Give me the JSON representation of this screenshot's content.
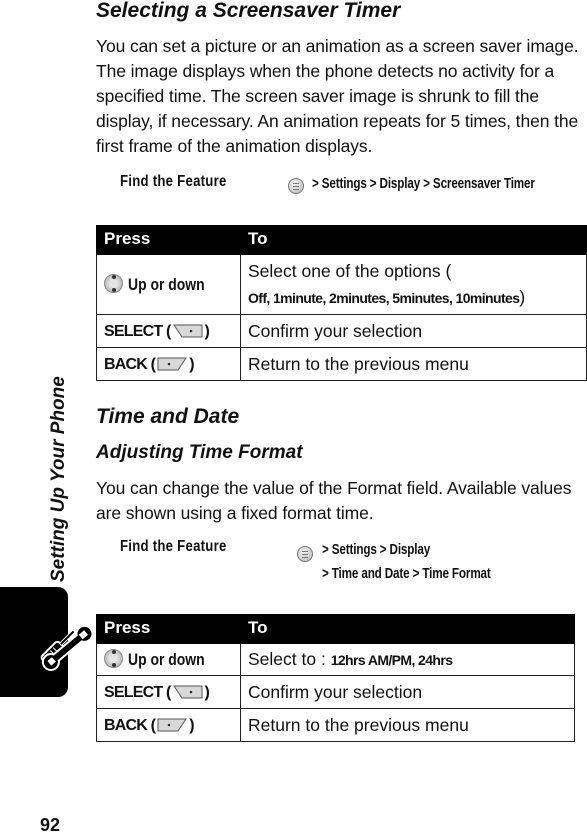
{
  "side_tab": {
    "label": "Setting Up Your Phone",
    "icon": "tools-icon"
  },
  "page_number": "92",
  "sections": [
    {
      "title": "Selecting a Screensaver Timer",
      "body": "You can set a picture or an animation as a screen saver image. The image displays when the phone detects no activity for a specified time. The screen saver image is shrunk to fill the display, if necessary. An animation repeats for 5 times, then the first frame of the animation displays.",
      "find_feature": {
        "label": "Find the Feature",
        "icon": "menu-key-icon",
        "path_lines": [
          "> Settings > Display > Screensaver Timer"
        ]
      },
      "table": {
        "headers": [
          "Press",
          "To"
        ],
        "rows": [
          {
            "press_icon": "nav-key-icon",
            "press": "Up or down",
            "to_prefix": "Select one of the options (",
            "to_options": "Off, 1minute, 2minutes, 5minutes, 10minutes",
            "to_suffix": ")"
          },
          {
            "press": "SELECT (",
            "press_icon": "right-softkey-icon",
            "press_suffix": ")",
            "to": "Confirm your selection"
          },
          {
            "press": "BACK (",
            "press_icon": "left-softkey-icon",
            "press_suffix": ")",
            "to": "Return to the previous menu"
          }
        ]
      }
    },
    {
      "title": "Time and Date",
      "subtitle": "Adjusting Time Format",
      "body": "You can change the value of the Format field. Available values are shown using a fixed format time.",
      "find_feature": {
        "label": "Find the Feature",
        "icon": "menu-key-icon",
        "path_lines": [
          "> Settings > Display",
          "> Time and Date > Time Format"
        ]
      },
      "table": {
        "headers": [
          "Press",
          "To"
        ],
        "rows": [
          {
            "press_icon": "nav-key-icon",
            "press": "Up or down",
            "to_prefix": "Select to : ",
            "to_options": "12hrs AM/PM,  24hrs",
            "to_suffix": ""
          },
          {
            "press": "SELECT (",
            "press_icon": "right-softkey-icon",
            "press_suffix": ")",
            "to": "Confirm your selection"
          },
          {
            "press": "BACK (",
            "press_icon": "left-softkey-icon",
            "press_suffix": ")",
            "to": "Return to the previous menu"
          }
        ]
      }
    }
  ]
}
